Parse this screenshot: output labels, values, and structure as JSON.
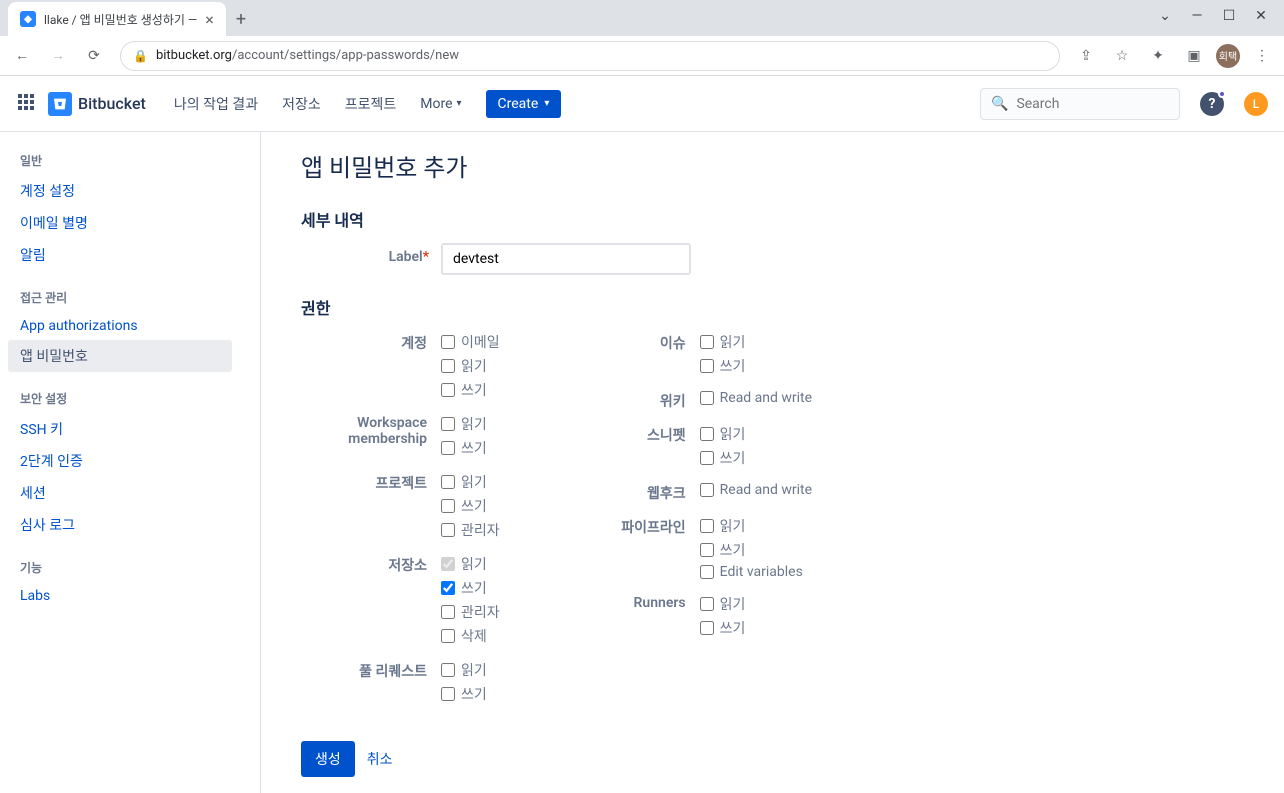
{
  "browser": {
    "tab_title": "llake / 앱 비밀번호 생성하기 —",
    "url_domain": "bitbucket.org",
    "url_path": "/account/settings/app-passwords/new",
    "profile_initial": "회택"
  },
  "header": {
    "logo": "Bitbucket",
    "nav": [
      "나의 작업 결과",
      "저장소",
      "프로젝트",
      "More"
    ],
    "create": "Create",
    "search_placeholder": "Search",
    "user_initial": "L"
  },
  "sidebar": {
    "sections": [
      {
        "heading": "일반",
        "items": [
          "계정 설정",
          "이메일 별명",
          "알림"
        ]
      },
      {
        "heading": "접근 관리",
        "items": [
          "App authorizations",
          "앱 비밀번호"
        ]
      },
      {
        "heading": "보안 설정",
        "items": [
          "SSH 키",
          "2단계 인증",
          "세션",
          "심사 로그"
        ]
      },
      {
        "heading": "기능",
        "items": [
          "Labs"
        ]
      }
    ],
    "active": "앱 비밀번호"
  },
  "page": {
    "title": "앱 비밀번호 추가",
    "details_heading": "세부 내역",
    "label_text": "Label",
    "label_value": "devtest",
    "perms_heading": "권한",
    "groups_left": [
      {
        "label": "계정",
        "opts": [
          {
            "t": "이메일",
            "c": false,
            "d": false
          },
          {
            "t": "읽기",
            "c": false,
            "d": false
          },
          {
            "t": "쓰기",
            "c": false,
            "d": false
          }
        ]
      },
      {
        "label": "Workspace membership",
        "opts": [
          {
            "t": "읽기",
            "c": false,
            "d": false
          },
          {
            "t": "쓰기",
            "c": false,
            "d": false
          }
        ]
      },
      {
        "label": "프로젝트",
        "opts": [
          {
            "t": "읽기",
            "c": false,
            "d": false
          },
          {
            "t": "쓰기",
            "c": false,
            "d": false
          },
          {
            "t": "관리자",
            "c": false,
            "d": false
          }
        ]
      },
      {
        "label": "저장소",
        "opts": [
          {
            "t": "읽기",
            "c": true,
            "d": true
          },
          {
            "t": "쓰기",
            "c": true,
            "d": false
          },
          {
            "t": "관리자",
            "c": false,
            "d": false
          },
          {
            "t": "삭제",
            "c": false,
            "d": false
          }
        ]
      },
      {
        "label": "풀 리퀘스트",
        "opts": [
          {
            "t": "읽기",
            "c": false,
            "d": false
          },
          {
            "t": "쓰기",
            "c": false,
            "d": false
          }
        ]
      }
    ],
    "groups_right": [
      {
        "label": "이슈",
        "opts": [
          {
            "t": "읽기",
            "c": false,
            "d": false
          },
          {
            "t": "쓰기",
            "c": false,
            "d": false
          }
        ]
      },
      {
        "label": "위키",
        "opts": [
          {
            "t": "Read and write",
            "c": false,
            "d": false
          }
        ]
      },
      {
        "label": "스니펫",
        "opts": [
          {
            "t": "읽기",
            "c": false,
            "d": false
          },
          {
            "t": "쓰기",
            "c": false,
            "d": false
          }
        ]
      },
      {
        "label": "웹후크",
        "opts": [
          {
            "t": "Read and write",
            "c": false,
            "d": false
          }
        ]
      },
      {
        "label": "파이프라인",
        "opts": [
          {
            "t": "읽기",
            "c": false,
            "d": false
          },
          {
            "t": "쓰기",
            "c": false,
            "d": false
          },
          {
            "t": "Edit variables",
            "c": false,
            "d": false
          }
        ]
      },
      {
        "label": "Runners",
        "opts": [
          {
            "t": "읽기",
            "c": false,
            "d": false
          },
          {
            "t": "쓰기",
            "c": false,
            "d": false
          }
        ]
      }
    ],
    "create_btn": "생성",
    "cancel_btn": "취소"
  }
}
